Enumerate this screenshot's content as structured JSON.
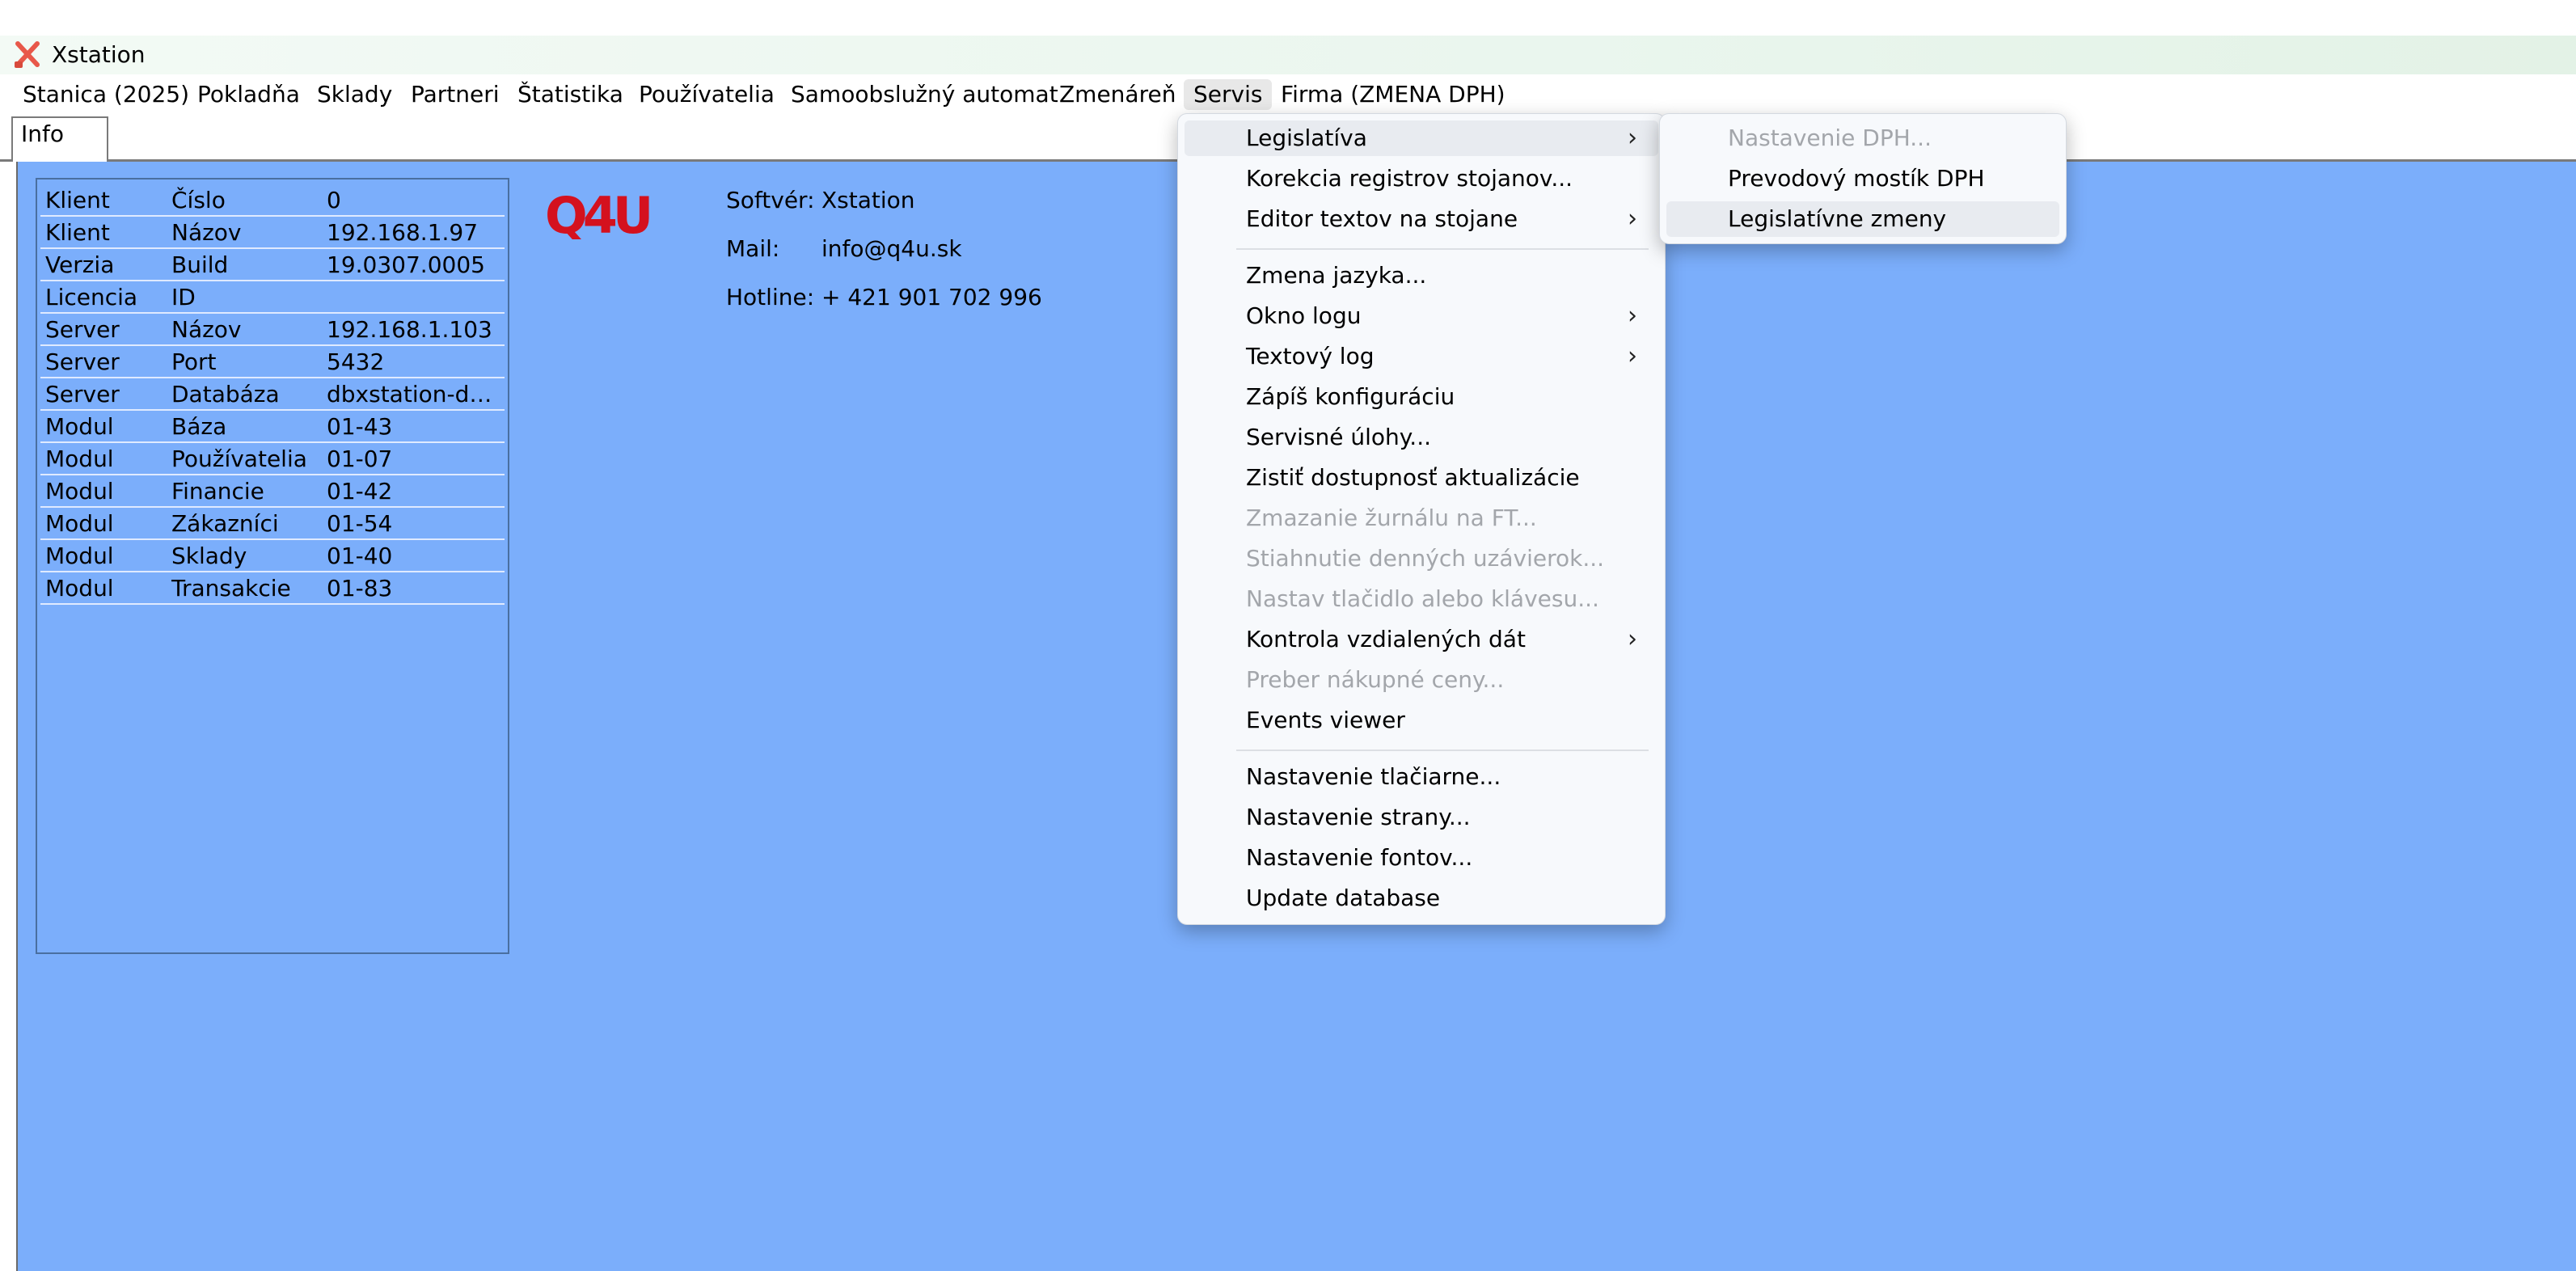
{
  "window": {
    "title": "Xstation"
  },
  "menubar": {
    "items": [
      "Stanica (2025)",
      "Pokladňa",
      "Sklady",
      "Partneri",
      "Štatistika",
      "Používatelia",
      "Samoobslužný automat",
      "Zmenáreň",
      "Servis",
      "Firma (ZMENA DPH)"
    ],
    "active": "Servis"
  },
  "tabs": {
    "active": "Info"
  },
  "info_table": {
    "rows": [
      [
        "Klient",
        "Číslo",
        "0"
      ],
      [
        "Klient",
        "Názov",
        "192.168.1.97"
      ],
      [
        "Verzia",
        "Build",
        "19.0307.0005"
      ],
      [
        "Licencia",
        "ID",
        ""
      ],
      [
        "Server",
        "Názov",
        "192.168.1.103"
      ],
      [
        "Server",
        "Port",
        "5432"
      ],
      [
        "Server",
        "Databáza",
        "dbxstation-dp..."
      ],
      [
        "Modul",
        "Báza",
        "01-43"
      ],
      [
        "Modul",
        "Používatelia",
        "01-07"
      ],
      [
        "Modul",
        "Financie",
        "01-42"
      ],
      [
        "Modul",
        "Zákazníci",
        "01-54"
      ],
      [
        "Modul",
        "Sklady",
        "01-40"
      ],
      [
        "Modul",
        "Transakcie",
        "01-83"
      ]
    ]
  },
  "logo": {
    "text": "Q4U",
    "color": "#d4111e"
  },
  "contact": {
    "software_label": "Softvér:",
    "software_value": "Xstation",
    "mail_label": "Mail:",
    "mail_value": "info@q4u.sk",
    "hotline_label": "Hotline:",
    "hotline_value": "+ 421 901 702 996"
  },
  "servis_menu": {
    "items": [
      {
        "label": "Legislatíva",
        "submenu": true,
        "disabled": false,
        "highlighted": true
      },
      {
        "label": "Korekcia registrov stojanov...",
        "submenu": false,
        "disabled": false
      },
      {
        "label": "Editor textov na stojane",
        "submenu": true,
        "disabled": false
      },
      {
        "separator": true
      },
      {
        "label": "Zmena jazyka...",
        "submenu": false,
        "disabled": false
      },
      {
        "label": "Okno logu",
        "submenu": true,
        "disabled": false
      },
      {
        "label": "Textový log",
        "submenu": true,
        "disabled": false
      },
      {
        "label": "Zápíš konfiguráciu",
        "submenu": false,
        "disabled": false
      },
      {
        "label": "Servisné úlohy...",
        "submenu": false,
        "disabled": false
      },
      {
        "label": "Zistiť dostupnosť aktualizácie",
        "submenu": false,
        "disabled": false
      },
      {
        "label": "Zmazanie žurnálu na FT...",
        "submenu": false,
        "disabled": true
      },
      {
        "label": "Stiahnutie denných uzávierok...",
        "submenu": false,
        "disabled": true
      },
      {
        "label": "Nastav tlačidlo alebo klávesu...",
        "submenu": false,
        "disabled": true
      },
      {
        "label": "Kontrola vzdialených dát",
        "submenu": true,
        "disabled": false
      },
      {
        "label": "Preber nákupné ceny...",
        "submenu": false,
        "disabled": true
      },
      {
        "label": "Events viewer",
        "submenu": false,
        "disabled": false
      },
      {
        "separator": true
      },
      {
        "label": "Nastavenie tlačiarne...",
        "submenu": false,
        "disabled": false
      },
      {
        "label": "Nastavenie strany...",
        "submenu": false,
        "disabled": false
      },
      {
        "label": "Nastavenie fontov...",
        "submenu": false,
        "disabled": false
      },
      {
        "label": "Update database",
        "submenu": false,
        "disabled": false
      }
    ]
  },
  "legislativa_submenu": {
    "items": [
      {
        "label": "Nastavenie DPH...",
        "disabled": true,
        "highlighted": false
      },
      {
        "label": "Prevodový mostík DPH",
        "disabled": false,
        "highlighted": false
      },
      {
        "label": "Legislatívne zmeny",
        "disabled": false,
        "highlighted": true
      }
    ]
  },
  "icons": {
    "submenu_arrow": "chevron-right-icon",
    "app_icon": "xstation-app-icon"
  },
  "colors": {
    "workspace_background": "#7baefb",
    "disabled_text": "#a3a6ab"
  }
}
